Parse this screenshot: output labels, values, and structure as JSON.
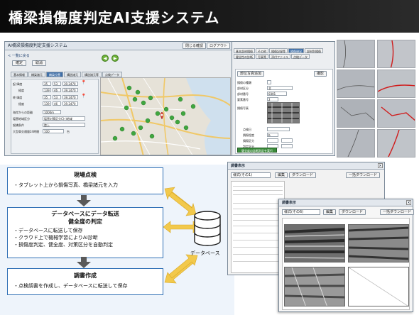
{
  "header": {
    "title": "橋梁損傷度判定AI支援システム"
  },
  "app": {
    "title": "AI橋梁損傷度判定支援システム",
    "btn_close": "閉じる確認",
    "btn_logout": "ログアウト",
    "back_link": "< 一覧に戻る",
    "btn_save": "確定",
    "btn_cancel": "取消",
    "tabs": [
      "基本情報",
      "橋梁諸元",
      "橋梁位置",
      "構造諸元",
      "構造諸元等",
      "点検データ"
    ],
    "tab_active_index": 2,
    "form_rows": [
      {
        "label": "起 緯度",
        "v1": "35",
        "v2": "53",
        "v3": "39.2470"
      },
      {
        "label": "経度",
        "v1": "139",
        "v2": "46",
        "v3": "39.2470"
      },
      {
        "label": "終 緯度",
        "v1": "35",
        "v2": "53",
        "v3": "39.2470"
      },
      {
        "label": "経度",
        "v1": "139",
        "v2": "46",
        "v3": "39.2470"
      }
    ],
    "misc_rows": [
      {
        "label": "海岸からの距離",
        "value": "1000m"
      },
      {
        "label": "塩害地域区分",
        "value": "塩害対策区分C(ｲ)地域"
      },
      {
        "label": "架橋条件",
        "value": "陸上"
      },
      {
        "label": "大型車交通量24時間",
        "value": "100"
      }
    ],
    "unit_m": "m",
    "unit_t": "台"
  },
  "detail": {
    "tabs": [
      "基本部材損傷",
      "その他",
      "損傷記録等",
      "損傷現況",
      "部材別損傷",
      "健全性の診断",
      "写真等",
      "添付ファイル",
      "点検データ"
    ],
    "tab_active_index": 3,
    "section_button": "部位写真追加",
    "btn_capture": "撮影",
    "rows": [
      {
        "label": "損傷の種類",
        "value": ""
      },
      {
        "label": "部材区分",
        "value": "主"
      },
      {
        "label": "部材番号",
        "value": "0301"
      },
      {
        "label": "要素番号",
        "value": "2"
      },
      {
        "label": "損傷写真",
        "value": ""
      },
      {
        "label": "点検日",
        "value": ""
      },
      {
        "label": "損傷程度",
        "value": "b"
      },
      {
        "label": "損傷区分",
        "value": ""
      },
      {
        "label": "判定区分",
        "value": ""
      }
    ],
    "green_button": "健全度の診断判定を実行"
  },
  "flow": {
    "box1": {
      "title": "現場点検",
      "body": "・タブレット上から損傷写真、橋梁諸元を入力"
    },
    "box2": {
      "title1": "データベースにデータ転送",
      "title2": "健全度の判定",
      "lines": [
        "・データベースに転送して保存",
        "・クラウド上で機械学習によりAI診断",
        "・損傷度判定、健全度、対策区分を自動判定"
      ]
    },
    "box3": {
      "title": "調書作成",
      "body": "・点検調書を作成し、データベースに転送して保存"
    },
    "db_label": "データベース"
  },
  "report1": {
    "title": "調書表示",
    "select_value": "様式(その1)",
    "btn_edit": "編集",
    "btn_download": "ダウンロード",
    "btn_bulk": "一括ダウンロード"
  },
  "report2": {
    "title": "調書表示",
    "select_value": "様式(その6)",
    "btn_edit": "編集",
    "btn_download": "ダウンロード",
    "btn_bulk": "一括ダウンロード"
  },
  "colors": {
    "accent_blue": "#2f6fb5",
    "arrow_yellow": "#f2c94c",
    "crack_red": "#d01c1c",
    "header_bg": "#111111",
    "map_pin_green": "#3fa63f",
    "map_pin_red": "#d9342b"
  },
  "icons": {
    "back_arrow": "left-arrow-icon",
    "forward_arrow": "right-arrow-icon",
    "database": "database-icon",
    "map_pin": "map-pin-icon"
  }
}
